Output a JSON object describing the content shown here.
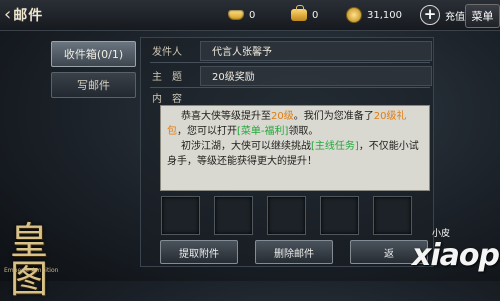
{
  "header": {
    "back_label": "邮件",
    "gold": "0",
    "bound_gold": "0",
    "coins": "31,100",
    "recharge_label": "充值",
    "menu_label": "菜单"
  },
  "tabs": {
    "inbox": "收件箱(0/1)",
    "compose": "写邮件"
  },
  "mail": {
    "sender_label": "发件人",
    "sender_value": "代言人张馨予",
    "subject_label": "主　题",
    "subject_value": "20级奖励",
    "content_label": "内　容",
    "p1_a": "恭喜大侠等级提升至",
    "p1_level": "20级",
    "p1_b": "。我们为您准备了",
    "p1_gift": "20级礼包",
    "p1_c": "，您可以打开",
    "p1_link": "[菜单-福利]",
    "p1_d": "领取。",
    "p2_a": "初涉江湖，大侠可以继续挑战",
    "p2_link": "[主线任务]",
    "p2_b": "，不仅能小试身手，等级还能获得更大的提升！"
  },
  "actions": {
    "collect": "提取附件",
    "delete": "删除邮件",
    "back": "返"
  },
  "logo": {
    "glyph": "皇图",
    "sub": "Emperor Ambition"
  },
  "watermark": {
    "small": "小皮",
    "big": "xiaopi"
  },
  "colors": {
    "highlight_orange": "#e07d12",
    "highlight_green": "#21a83a"
  }
}
